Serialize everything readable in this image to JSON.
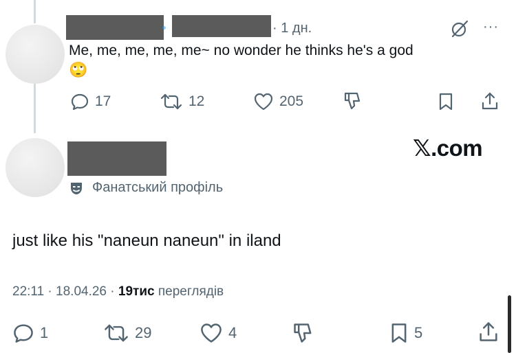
{
  "post": {
    "time_sep": "·",
    "time": "1 дн.",
    "text": "Me, me, me, me, me~ no wonder he thinks he's a god",
    "emoji": "🙄",
    "more": "···",
    "actions": {
      "replies": "17",
      "reposts": "12",
      "likes": "205"
    }
  },
  "watermark": "𝕏.com",
  "reply": {
    "badge_label": "Фанатський профіль",
    "text": "just like his \"naneun naneun\" in iland",
    "meta": {
      "time": "22:11",
      "sep1": "·",
      "date": "18.04.26",
      "sep2": "·",
      "views_count": "19тис",
      "views_label": "переглядів"
    },
    "actions": {
      "replies": "1",
      "reposts": "29",
      "likes": "4",
      "bookmarks": "5"
    }
  },
  "colors": {
    "muted": "#536471",
    "text": "#0f1419",
    "redaction": "#5b5b5b"
  }
}
